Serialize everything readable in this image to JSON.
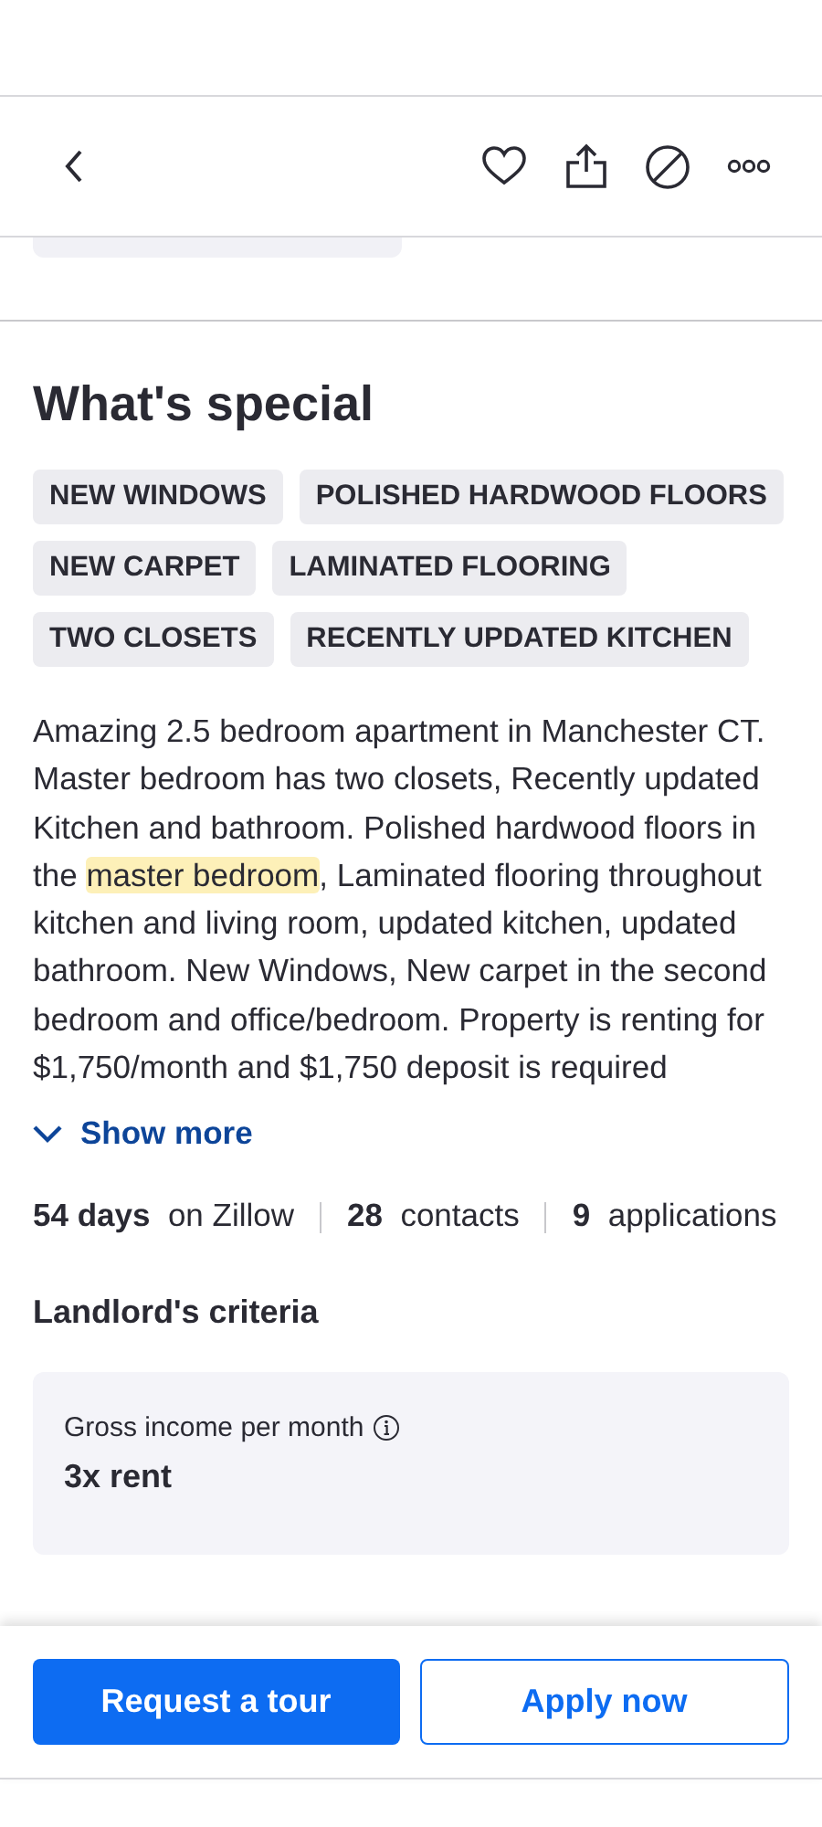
{
  "header": {
    "actions": [
      {
        "kind": "heart"
      },
      {
        "kind": "share"
      },
      {
        "kind": "hide"
      },
      {
        "kind": "more"
      }
    ]
  },
  "special": {
    "title": "What's special",
    "tags": [
      "NEW WINDOWS",
      "POLISHED HARDWOOD FLOORS",
      "NEW CARPET",
      "LAMINATED FLOORING",
      "TWO CLOSETS",
      "RECENTLY UPDATED KITCHEN"
    ],
    "description": {
      "before": "Amazing 2.5 bedroom apartment in Manchester CT. Master bedroom has two closets, Recently updated Kitchen and bathroom. Polished hardwood floors in the ",
      "highlight": "master bedroom",
      "after": ", Laminated flooring throughout kitchen and living room, updated kitchen, updated bathroom. New Windows, New carpet in the second bedroom and office/bedroom. Property is renting for $1,750/month and $1,750 deposit is required"
    },
    "show_more": "Show more",
    "stats": [
      "**54 days** on Zillow",
      "**28** contacts",
      "**9** applications"
    ]
  },
  "criteria": {
    "title": "Landlord's criteria",
    "label": "Gross income per month",
    "value": "3x rent"
  },
  "buttons": [
    {
      "label": "Request a tour",
      "kind": "primary"
    },
    {
      "label": "Apply now",
      "kind": "secondary"
    }
  ]
}
